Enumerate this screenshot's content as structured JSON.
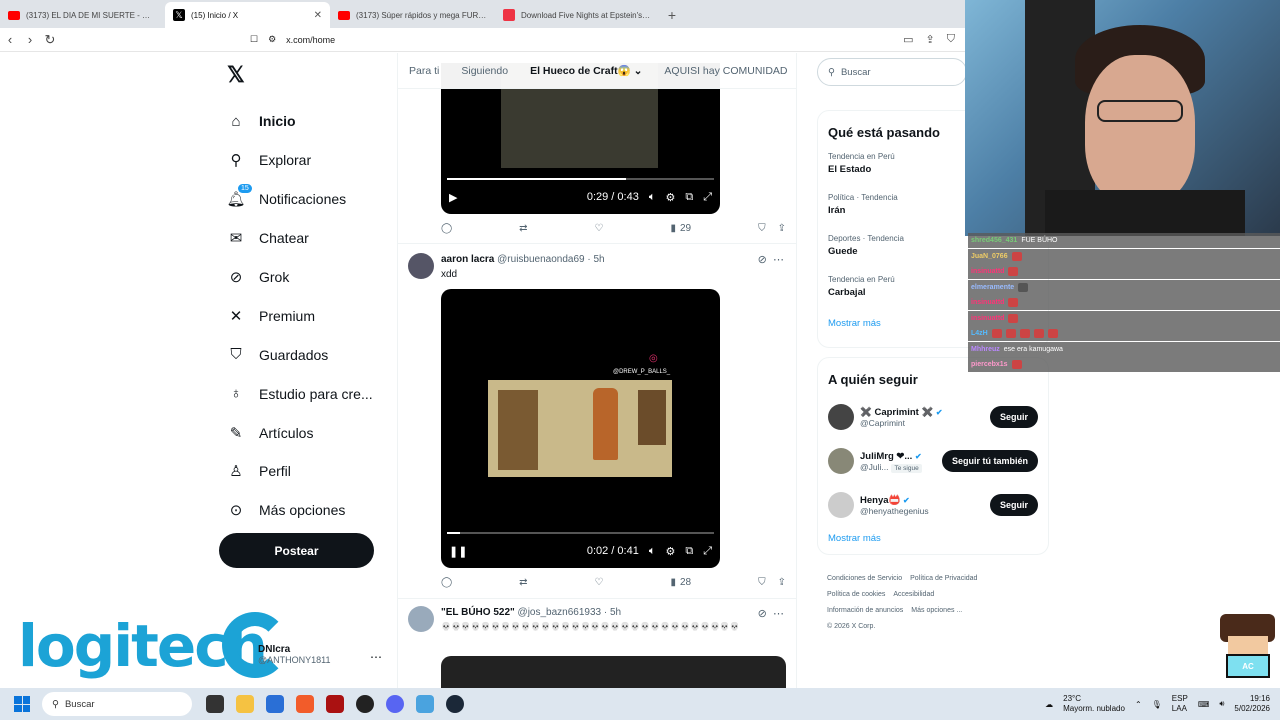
{
  "browser": {
    "tabs": [
      {
        "label": "(3173) EL DIA DE MI SUERTE - WILLIE",
        "icon": "youtube-icon",
        "active": false
      },
      {
        "label": "(15) Inicio / X",
        "icon": "x-icon",
        "active": true
      },
      {
        "label": "(3173) Súper rápidos y mega FURIOS",
        "icon": "youtube-icon",
        "active": false
      },
      {
        "label": "Download Five Nights at Epstein's by",
        "icon": "pdf-icon",
        "active": false
      }
    ],
    "url": "x.com/home"
  },
  "nav": {
    "items": [
      {
        "label": "Inicio",
        "icon": "home-icon"
      },
      {
        "label": "Explorar",
        "icon": "search-icon"
      },
      {
        "label": "Notificaciones",
        "icon": "bell-icon",
        "badge": "15"
      },
      {
        "label": "Chatear",
        "icon": "mail-icon"
      },
      {
        "label": "Grok",
        "icon": "grok-icon"
      },
      {
        "label": "Premium",
        "icon": "x-icon"
      },
      {
        "label": "Guardados",
        "icon": "bookmark-icon"
      },
      {
        "label": "Estudio para cre...",
        "icon": "studio-icon"
      },
      {
        "label": "Artículos",
        "icon": "article-icon"
      },
      {
        "label": "Perfil",
        "icon": "person-icon"
      },
      {
        "label": "Más opciones",
        "icon": "more-icon"
      }
    ],
    "post_label": "Postear"
  },
  "feed_tabs": [
    "Para ti",
    "Siguiendo",
    "El Hueco de Craft😱",
    "AQUISI hay COMUNIDAD"
  ],
  "tweets": [
    {
      "video_time": "0:29 / 0:43",
      "video_progress": 0.67,
      "views": "29"
    },
    {
      "author": "aaron lacra",
      "handle": "@ruisbuenaonda69 · 5h",
      "text": "xdd",
      "video_watermark": "@DREW_P_BALLS_",
      "video_time": "0:02 / 0:41",
      "video_progress": 0.05,
      "views": "28"
    },
    {
      "author": "\"EL BÚHO 522\"",
      "handle": "@jos_bazn661933 · 5h",
      "text": "💀💀💀💀💀💀💀💀💀💀💀💀💀💀💀💀💀💀💀💀💀💀💀💀💀💀💀💀💀💀"
    }
  ],
  "search_placeholder": "Buscar",
  "trends": {
    "title": "Qué está pasando",
    "items": [
      {
        "category": "Tendencia en Perú",
        "name": "El Estado"
      },
      {
        "category": "Política · Tendencia",
        "name": "Irán"
      },
      {
        "category": "Deportes · Tendencia",
        "name": "Guede"
      },
      {
        "category": "Tendencia en Perú",
        "name": "Carbajal"
      }
    ],
    "show_more": "Mostrar más"
  },
  "who_to_follow": {
    "title": "A quién seguir",
    "items": [
      {
        "name": "✖️ Caprimint ✖️",
        "handle": "@Caprimint",
        "button": "Seguir",
        "follows_you": ""
      },
      {
        "name": "JuliMrg ❤...",
        "handle": "@Juli...",
        "button": "Seguir tú también",
        "follows_you": "Te sigue"
      },
      {
        "name": "Henya📛",
        "handle": "@henyathegenius",
        "button": "Seguir",
        "follows_you": ""
      }
    ],
    "show_more": "Mostrar más"
  },
  "footer": [
    "Condiciones de Servicio",
    "Política de Privacidad",
    "Política de cookies",
    "Accesibilidad",
    "Información de anuncios",
    "Más opciones ...",
    "© 2026 X Corp."
  ],
  "chat": [
    {
      "user": "shred456_431",
      "msg": "FUE BÚHO"
    },
    {
      "user": "JuaN_0766",
      "msg": ""
    },
    {
      "user": "insinuattd",
      "msg": ""
    },
    {
      "user": "elmeramente",
      "msg": ""
    },
    {
      "user": "insinuattd",
      "msg": ""
    },
    {
      "user": "insinuattd",
      "msg": ""
    },
    {
      "user": "L4zH",
      "msg": ""
    },
    {
      "user": "Mhhreuz",
      "msg": "ese era kamugawa"
    },
    {
      "user": "piercebx1s",
      "msg": ""
    }
  ],
  "overlay": {
    "brand": "logitech",
    "profile_name": "DNIcra",
    "profile_handle": "@ANTHONY1811"
  },
  "taskbar": {
    "search_placeholder": "Buscar",
    "weather_temp": "23°C",
    "weather_desc": "Mayorm. nublado",
    "lang": "ESP",
    "lang2": "LAA",
    "time": "19:16",
    "date": "5/02/2026"
  }
}
